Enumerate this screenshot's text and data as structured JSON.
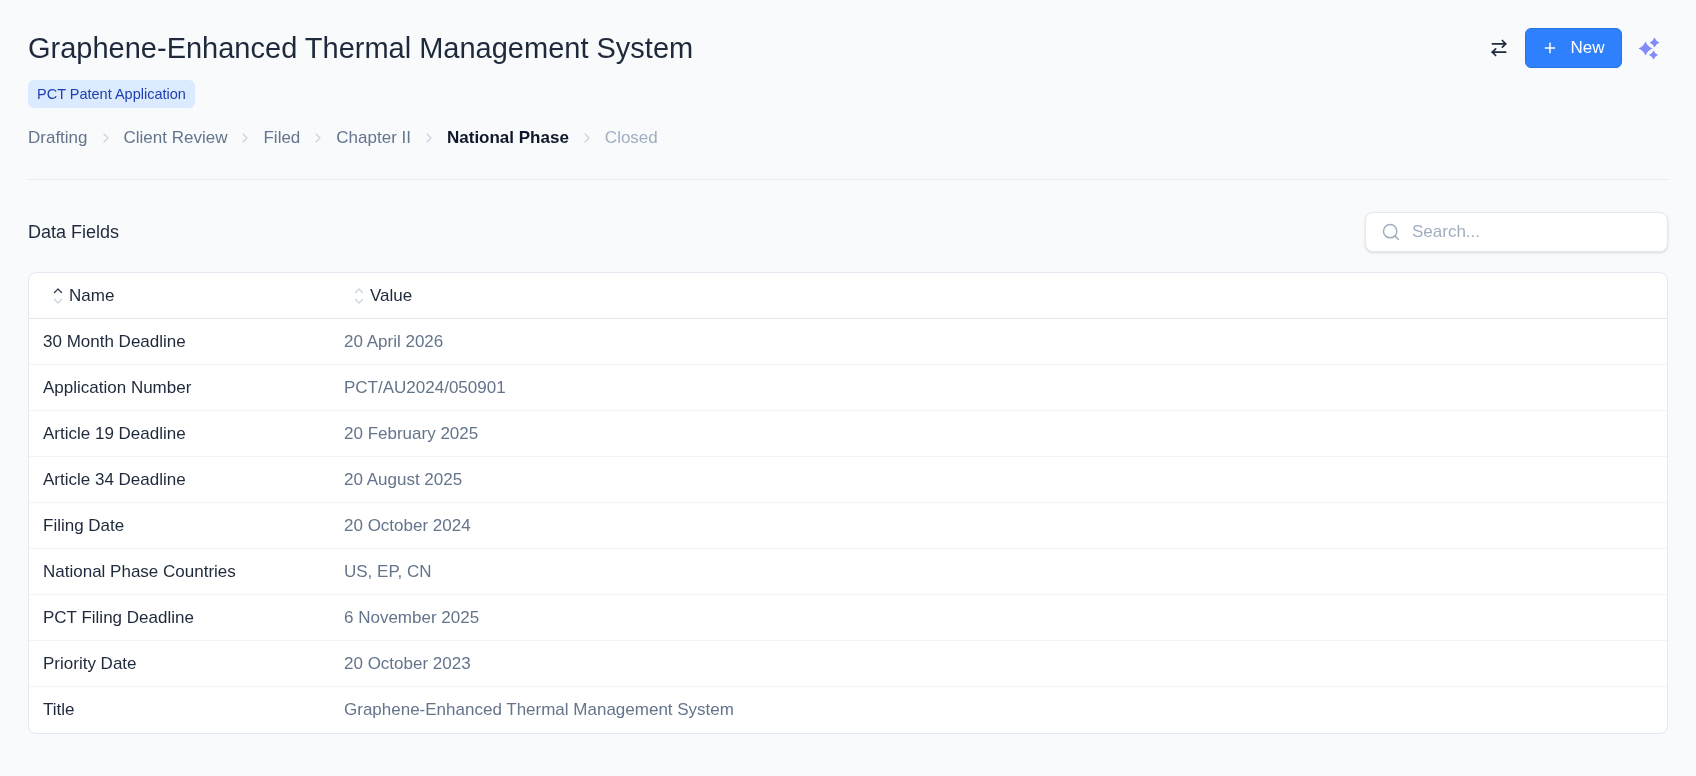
{
  "header": {
    "title": "Graphene-Enhanced Thermal Management System",
    "badge": "PCT Patent Application",
    "new_button": "New"
  },
  "steps": [
    {
      "label": "Drafting",
      "upcoming": false,
      "selected": false
    },
    {
      "label": "Client Review",
      "upcoming": false,
      "selected": false
    },
    {
      "label": "Filed",
      "upcoming": false,
      "selected": false
    },
    {
      "label": "Chapter II",
      "upcoming": false,
      "selected": false
    },
    {
      "label": "National Phase",
      "upcoming": false,
      "selected": true
    },
    {
      "label": "Closed",
      "upcoming": true,
      "selected": false
    }
  ],
  "section": {
    "title": "Data Fields",
    "search": {
      "placeholder": "Search..."
    }
  },
  "table": {
    "columns": [
      {
        "label": "Name",
        "sorted": true
      },
      {
        "label": "Value",
        "sorted": false
      }
    ],
    "rows": [
      {
        "name": "30 Month Deadline",
        "value": "20 April 2026"
      },
      {
        "name": "Application Number",
        "value": "PCT/AU2024/050901"
      },
      {
        "name": "Article 19 Deadline",
        "value": "20 February 2025"
      },
      {
        "name": "Article 34 Deadline",
        "value": "20 August 2025"
      },
      {
        "name": "Filing Date",
        "value": "20 October 2024"
      },
      {
        "name": "National Phase Countries",
        "value": "US, EP, CN"
      },
      {
        "name": "PCT Filing Deadline",
        "value": "6 November 2025"
      },
      {
        "name": "Priority Date",
        "value": "20 October 2023"
      },
      {
        "name": "Title",
        "value": "Graphene-Enhanced Thermal Management System"
      }
    ]
  }
}
